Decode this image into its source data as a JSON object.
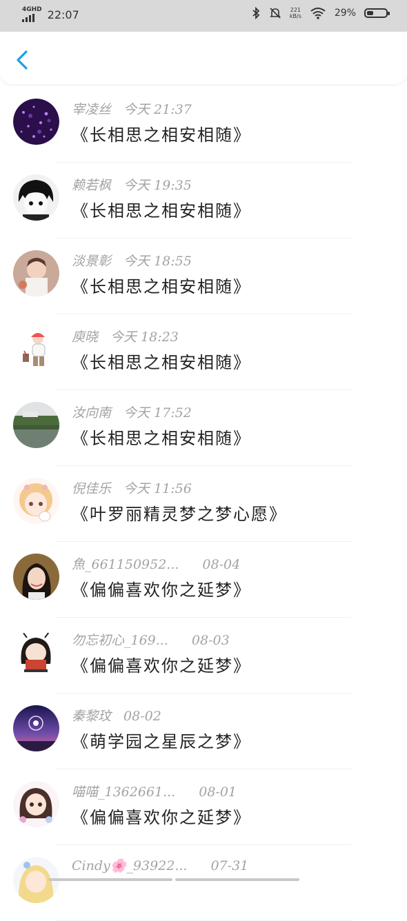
{
  "status_bar": {
    "network": "4GHD",
    "time": "22:07",
    "speed_value": "221",
    "speed_unit": "kB/s",
    "battery": "29%",
    "battery_level": 0.29,
    "icons": [
      "bluetooth-icon",
      "mute-icon",
      "wifi-icon",
      "battery-icon"
    ]
  },
  "nav": {
    "back_icon": "chevron-left-icon",
    "accent": "#1e9ee6"
  },
  "items": [
    {
      "name": "宰凌丝",
      "time": "今天 21:37",
      "title": "《长相思之相安相随》",
      "avatar": "purple-sparkle"
    },
    {
      "name": "赖若枫",
      "time": "今天 19:35",
      "title": "《长相思之相安相随》",
      "avatar": "anime-boy"
    },
    {
      "name": "淡景彰",
      "time": "今天 18:55",
      "title": "《长相思之相安相随》",
      "avatar": "child-photo"
    },
    {
      "name": "庾晓",
      "time": "今天 18:23",
      "title": "《长相思之相安相随》",
      "avatar": "cartoon-figure"
    },
    {
      "name": "汝向南",
      "time": "今天 17:52",
      "title": "《长相思之相安相随》",
      "avatar": "lake-scene"
    },
    {
      "name": "倪佳乐",
      "time": "今天 11:56",
      "title": "《叶罗丽精灵梦之梦心愿》",
      "avatar": "anime-girl"
    },
    {
      "name": "魚_661150952...",
      "time": "08-04",
      "title": "《偏偏喜欢你之延梦》",
      "avatar": "girl-photo"
    },
    {
      "name": "勿忘初心_169...",
      "time": "08-03",
      "title": "《偏偏喜欢你之延梦》",
      "avatar": "chibi-girl"
    },
    {
      "name": "秦黎玟",
      "time": "08-02",
      "title": "《萌学园之星辰之梦》",
      "avatar": "night-sky"
    },
    {
      "name": "喵喵_1362661...",
      "time": "08-01",
      "title": "《偏偏喜欢你之延梦》",
      "avatar": "doll-girl"
    },
    {
      "name": "Cindy🌸_93922...",
      "time": "07-31",
      "title": "",
      "avatar": "blonde-girl"
    }
  ]
}
